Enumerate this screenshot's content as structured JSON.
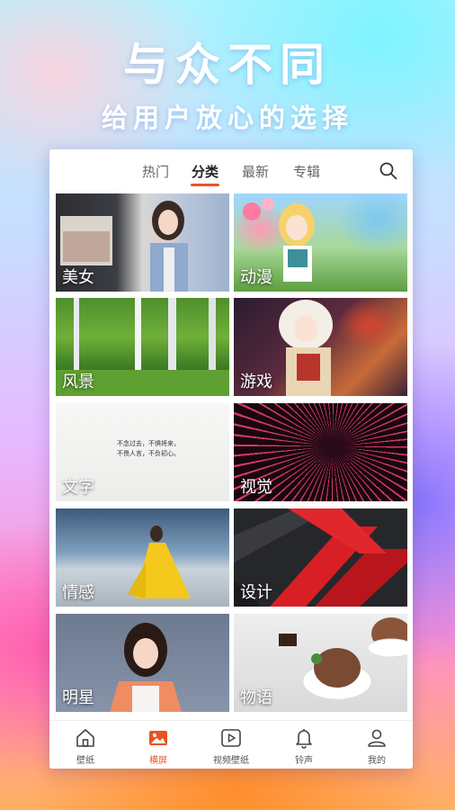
{
  "banner": {
    "headline": "与众不同",
    "subheadline": "给用户放心的选择"
  },
  "tabs": [
    {
      "label": "热门"
    },
    {
      "label": "分类",
      "active": true
    },
    {
      "label": "最新"
    },
    {
      "label": "专辑"
    }
  ],
  "search": {
    "icon": "search-icon"
  },
  "categories": [
    {
      "label": "美女"
    },
    {
      "label": "动漫"
    },
    {
      "label": "风景"
    },
    {
      "label": "游戏"
    },
    {
      "label": "文字",
      "quote": [
        "不念过去，不惧将来，",
        "不畏人言，不负初心。"
      ]
    },
    {
      "label": "视觉"
    },
    {
      "label": "情感"
    },
    {
      "label": "设计"
    },
    {
      "label": "明星"
    },
    {
      "label": "物语"
    }
  ],
  "bottom_nav": [
    {
      "label": "壁纸",
      "icon": "home-icon"
    },
    {
      "label": "横屏",
      "icon": "image-icon",
      "active": true
    },
    {
      "label": "视频壁纸",
      "icon": "video-icon"
    },
    {
      "label": "铃声",
      "icon": "bell-icon"
    },
    {
      "label": "我的",
      "icon": "profile-icon"
    }
  ],
  "colors": {
    "accent": "#e8541e",
    "nav_text": "#555555"
  }
}
